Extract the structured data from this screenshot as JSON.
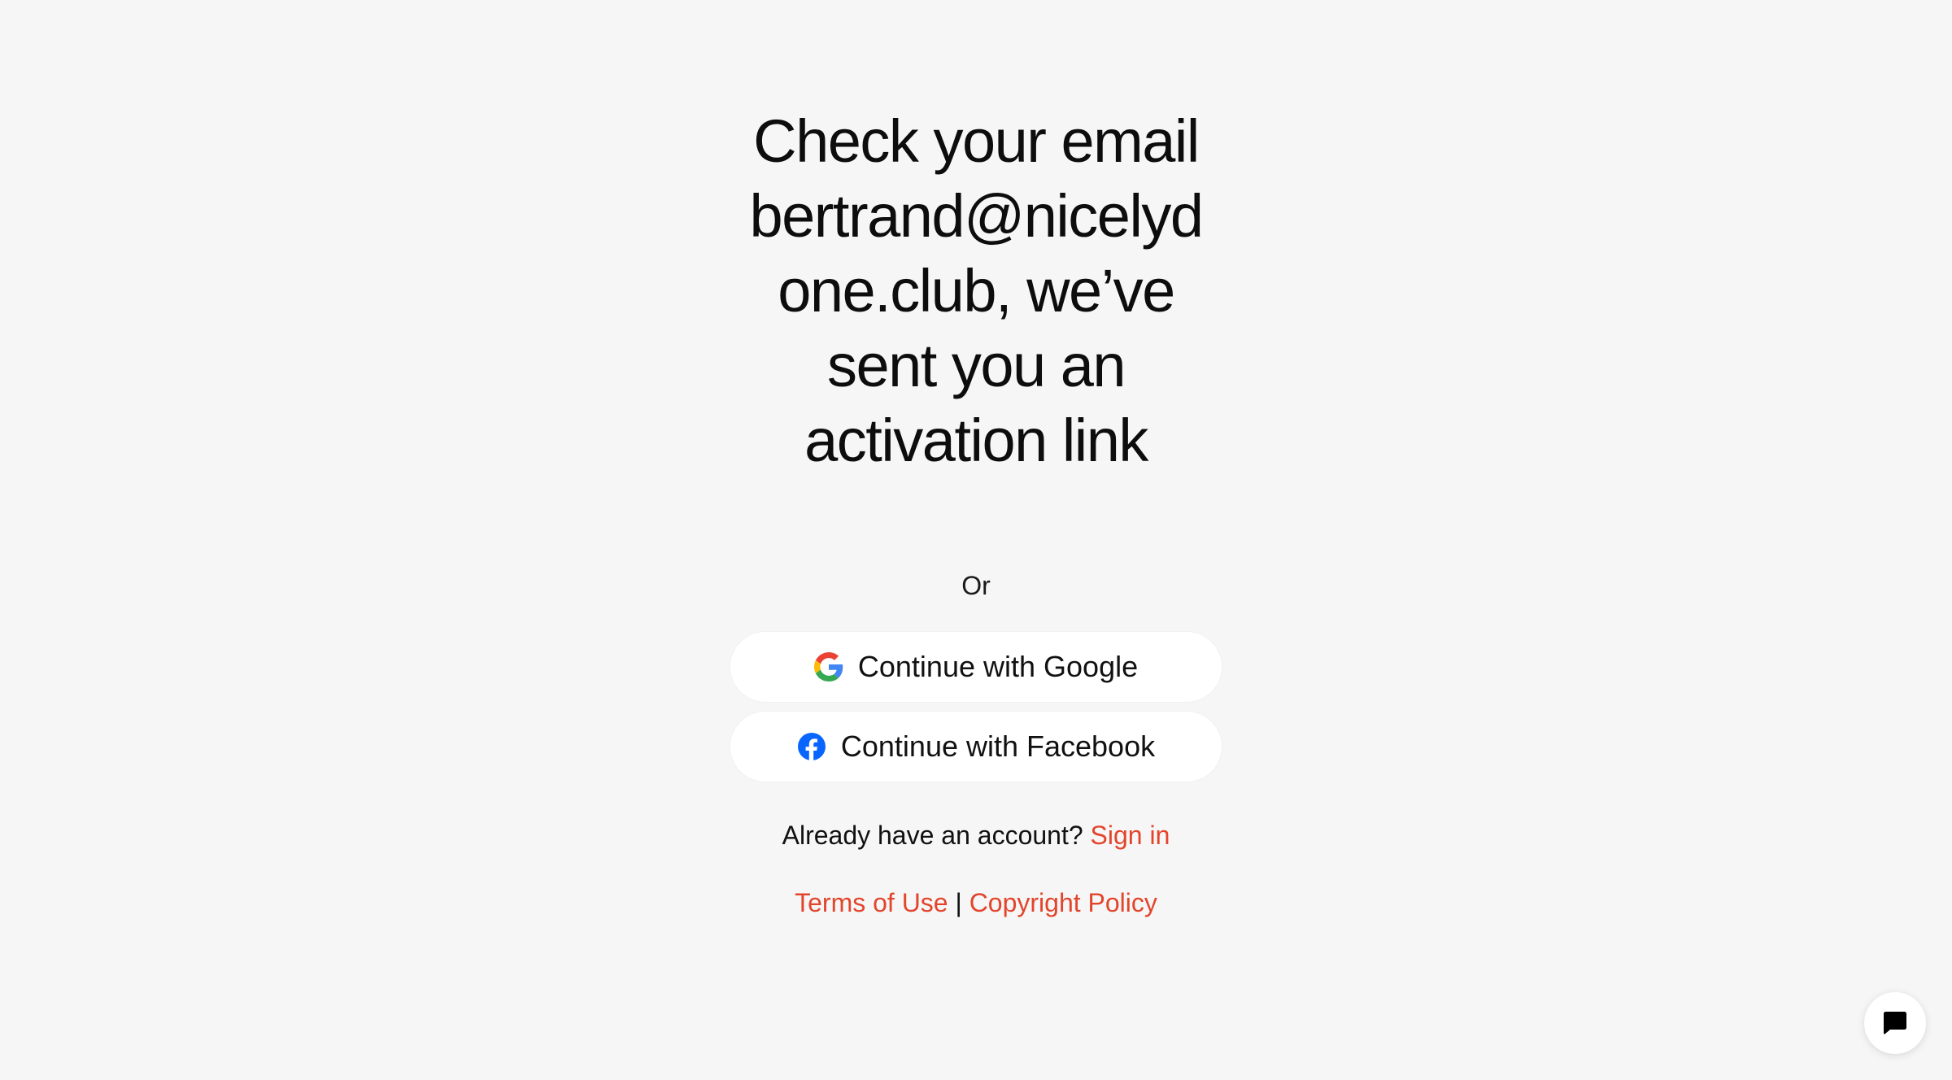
{
  "heading": {
    "line1": "Check your email",
    "line2": "bertrand@nicelyd",
    "line3": "one.club, we’ve",
    "line4": "sent you an",
    "line5": "activation link"
  },
  "divider_text": "Or",
  "social": {
    "google_label": "Continue with Google",
    "facebook_label": "Continue with Facebook"
  },
  "account": {
    "prompt": "Already have an account?",
    "signin_label": "Sign in"
  },
  "legal": {
    "terms_label": "Terms of Use",
    "separator": "|",
    "copyright_label": "Copyright Policy"
  },
  "icons": {
    "google": "google-icon",
    "facebook": "facebook-icon",
    "chat": "chat-bubble-icon"
  },
  "colors": {
    "background": "#f6f6f6",
    "accent_link": "#e3452c",
    "facebook_blue": "#0866ff",
    "button_bg": "#ffffff"
  }
}
